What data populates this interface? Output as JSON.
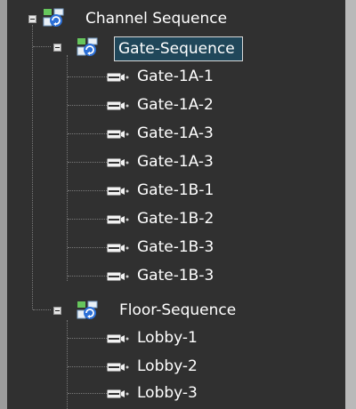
{
  "tree": {
    "root": {
      "label": "Channel Sequence",
      "expanded": true
    },
    "groups": [
      {
        "label": "Gate-Sequence",
        "selected": true,
        "expanded": true,
        "items": [
          "Gate-1A-1",
          "Gate-1A-2",
          "Gate-1A-3",
          "Gate-1A-3",
          "Gate-1B-1",
          "Gate-1B-2",
          "Gate-1B-3",
          "Gate-1B-3"
        ]
      },
      {
        "label": "Floor-Sequence",
        "selected": false,
        "expanded": true,
        "items": [
          "Lobby-1",
          "Lobby-2",
          "Lobby-3"
        ]
      }
    ]
  },
  "colors": {
    "panel_bg": "#303030",
    "selection_bg": "#20475a",
    "text": "#ffffff"
  },
  "icons": {
    "sequence": "sequence-icon",
    "camera": "camera-icon",
    "collapse": "collapse-icon"
  }
}
